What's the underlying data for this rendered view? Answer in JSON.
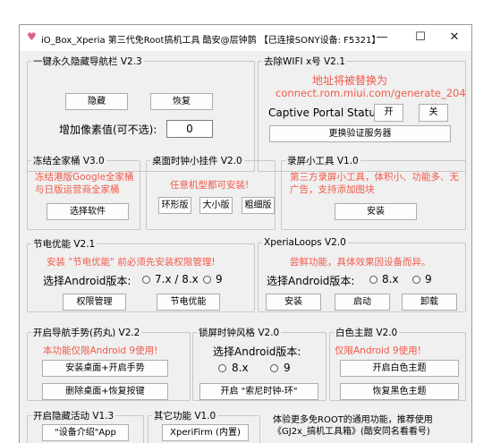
{
  "window": {
    "title": "iO_Box_Xperia 第三代免Root搞机工具 酷安@层钟鹊 【已连接SONY设备: F5321】",
    "controls": {
      "minimize": "—",
      "maximize": "☐",
      "close": "✕"
    }
  },
  "nav_hide": {
    "legend": "一键永久隐藏导航栏 V2.3",
    "hide_label": "隐藏",
    "restore_label": "恢复",
    "pixel_label": "增加像素值(可不选):",
    "pixel_value": "0"
  },
  "wifi_x": {
    "legend": "去除WIFI x号 V2.1",
    "note_line1": "地址将被替换为",
    "note_line2": "connect.rom.miui.com/generate_204",
    "status_label": "Captive Portal Status:",
    "on_label": "开",
    "off_label": "关",
    "change_server_label": "更换验证服务器"
  },
  "freeze": {
    "legend": "冻结全家桶 V3.0",
    "note": "冻结港版Google全家桶与日版运营商全家桶",
    "select_label": "选择软件"
  },
  "clock_widget": {
    "legend": "桌面时钟小挂件 V2.0",
    "note": "任意机型都可安装!",
    "ring_label": "环形版",
    "big_label": "大小版",
    "thin_label": "粗细版"
  },
  "recorder": {
    "legend": "录屏小工具 V1.0",
    "note": "第三方录屏小工具，体积小、功能多、无广告，支持添加图块",
    "install_label": "安装"
  },
  "power_saving": {
    "legend": "节电优能 V2.1",
    "note": "安装 \"节电优能\" 前必须先安装权限管理!",
    "android_label": "选择Android版本:",
    "opt1": "7.x / 8.x",
    "opt2": "9",
    "perm_label": "权限管理",
    "power_label": "节电优能"
  },
  "xperia_loops": {
    "legend": "XperiaLoops V2.0",
    "note": "尝鲜功能，具体效果因设备而异。",
    "android_label": "选择Android版本:",
    "opt1": "8.x",
    "opt2": "9",
    "install_label": "安装",
    "start_label": "启动",
    "uninstall_label": "卸载"
  },
  "nav_gesture": {
    "legend": "开启导航手势(药丸) V2.2",
    "note": "本功能仅限Android 9使用!",
    "enable_label": "安装桌面+开启手势",
    "restore_label": "删除桌面+恢复按键"
  },
  "lock_clock": {
    "legend": "锁屏时钟风格 V2.0",
    "android_label": "选择Android版本:",
    "opt1": "8.x",
    "opt2": "9",
    "enable_label": "开启 \"索尼时钟-环\""
  },
  "white_theme": {
    "legend": "白色主题 V2.0",
    "note": "仅限Android 9使用!",
    "white_label": "开启白色主题",
    "black_label": "恢复黑色主题"
  },
  "hidden_activity": {
    "legend": "开启隐藏活动 V1.3",
    "device_info_label": "\"设备介绍\"App"
  },
  "other": {
    "legend": "其它功能 V1.0",
    "xperifirm_label": "XperiFirm (内置)"
  },
  "footer_note": "体验更多免ROOT的通用功能，推荐使用《GJ2x_搞机工具箱》(酷安同名看看号)"
}
